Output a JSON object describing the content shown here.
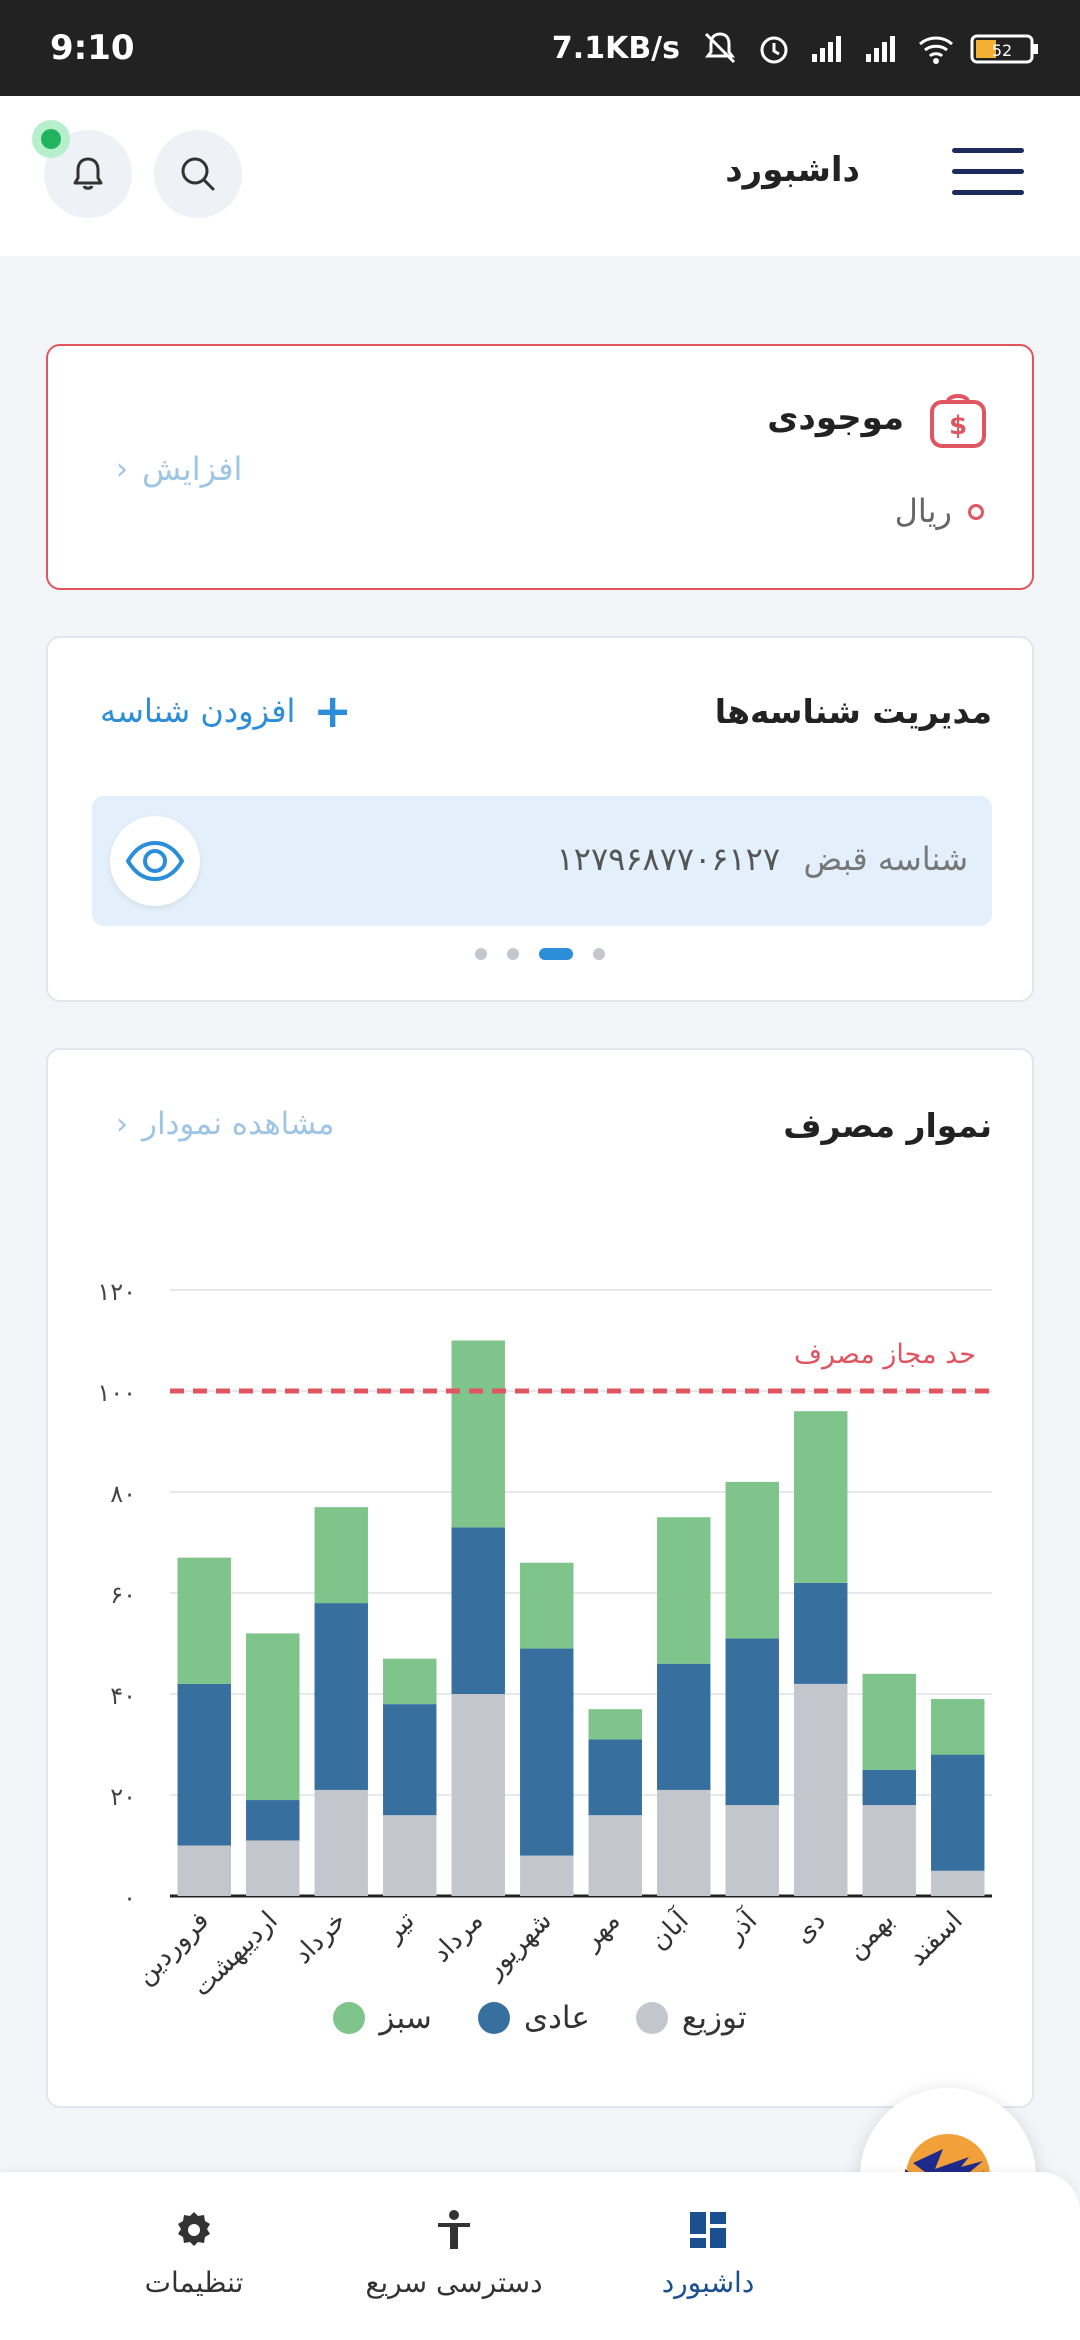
{
  "status_bar": {
    "time": "9:10",
    "net_speed": "7.1KB/s",
    "battery": "52"
  },
  "app_bar": {
    "title": "داشبورد"
  },
  "balance_card": {
    "title": "موجودی",
    "unit": "ریال",
    "increase_label": "افزایش"
  },
  "ids_card": {
    "title": "مدیریت شناسه‌ها",
    "add_label": "افزودن شناسه",
    "id_label": "شناسه قبض",
    "id_value": "۱۲۷۹۶۸۷۷۰۶۱۲۷",
    "pager": {
      "count": 4,
      "active_index_from_left": 2
    }
  },
  "chart_card": {
    "title": "نموار مصرف",
    "link_label": "مشاهده نمودار"
  },
  "chart_data": {
    "type": "bar",
    "stacked": true,
    "categories": [
      "فروردین",
      "اردیبهشت",
      "خرداد",
      "تیر",
      "مرداد",
      "شهریور",
      "مهر",
      "آبان",
      "آذر",
      "دی",
      "بهمن",
      "اسفند"
    ],
    "series": [
      {
        "name": "توزیع",
        "color": "#c3c7cd",
        "values": [
          10,
          11,
          21,
          16,
          40,
          8,
          16,
          21,
          18,
          42,
          18,
          5
        ]
      },
      {
        "name": "عادی",
        "color": "#37709f",
        "values": [
          32,
          8,
          37,
          22,
          33,
          41,
          15,
          25,
          33,
          20,
          7,
          23
        ]
      },
      {
        "name": "سبز",
        "color": "#7ec48b",
        "values": [
          25,
          33,
          19,
          9,
          37,
          17,
          6,
          29,
          31,
          34,
          19,
          11
        ]
      }
    ],
    "ylim": [
      0,
      120
    ],
    "yticks": [
      "۰",
      "۲۰",
      "۴۰",
      "۶۰",
      "۸۰",
      "۱۰۰",
      "۱۲۰"
    ],
    "limit_line": {
      "value": 100,
      "label": "حد مجاز مصرف",
      "color": "#e05560"
    },
    "grid": true,
    "legend": "bottom"
  },
  "bottom_nav": {
    "dashboard": "داشبورد",
    "quick_access": "دسترسی سریع",
    "settings": "تنظیمات"
  }
}
